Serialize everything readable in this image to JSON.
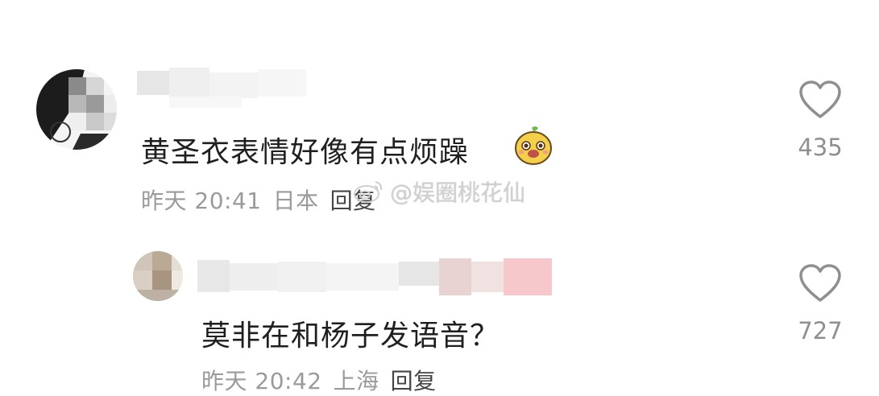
{
  "comments": [
    {
      "text": "黄圣衣表情好像有点烦躁",
      "time": "昨天 20:41",
      "location": "日本",
      "reply_label": "回复",
      "likes": "435",
      "emoji_icon": "cartoon-face-emoji-icon",
      "heart_icon": "heart-outline-icon"
    },
    {
      "text": "莫非在和杨子发语音？",
      "time": "昨天 20:42",
      "location": "上海",
      "reply_label": "回复",
      "likes": "727",
      "heart_icon": "heart-outline-icon"
    }
  ],
  "watermark": {
    "text": "@娱圈桃花仙",
    "icon": "weibo-logo-icon"
  }
}
